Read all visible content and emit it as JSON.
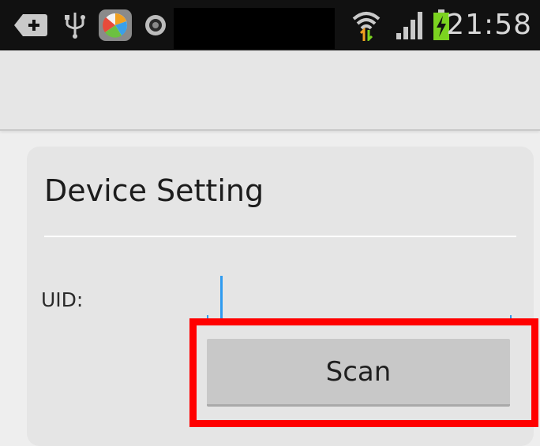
{
  "status_bar": {
    "time": "21:58",
    "icons": [
      "add-box-icon",
      "usb-icon",
      "app-pinwheel-icon",
      "camera-icon",
      "wifi-icon",
      "signal-icon",
      "battery-charging-icon"
    ]
  },
  "card": {
    "title": "Device Setting",
    "uid_label": "UID:",
    "uid_value": ""
  },
  "scan_button": {
    "label": "Scan"
  },
  "colors": {
    "cursor": "#2f9bf0",
    "highlight": "#ff0000",
    "battery": "#7bd320"
  }
}
